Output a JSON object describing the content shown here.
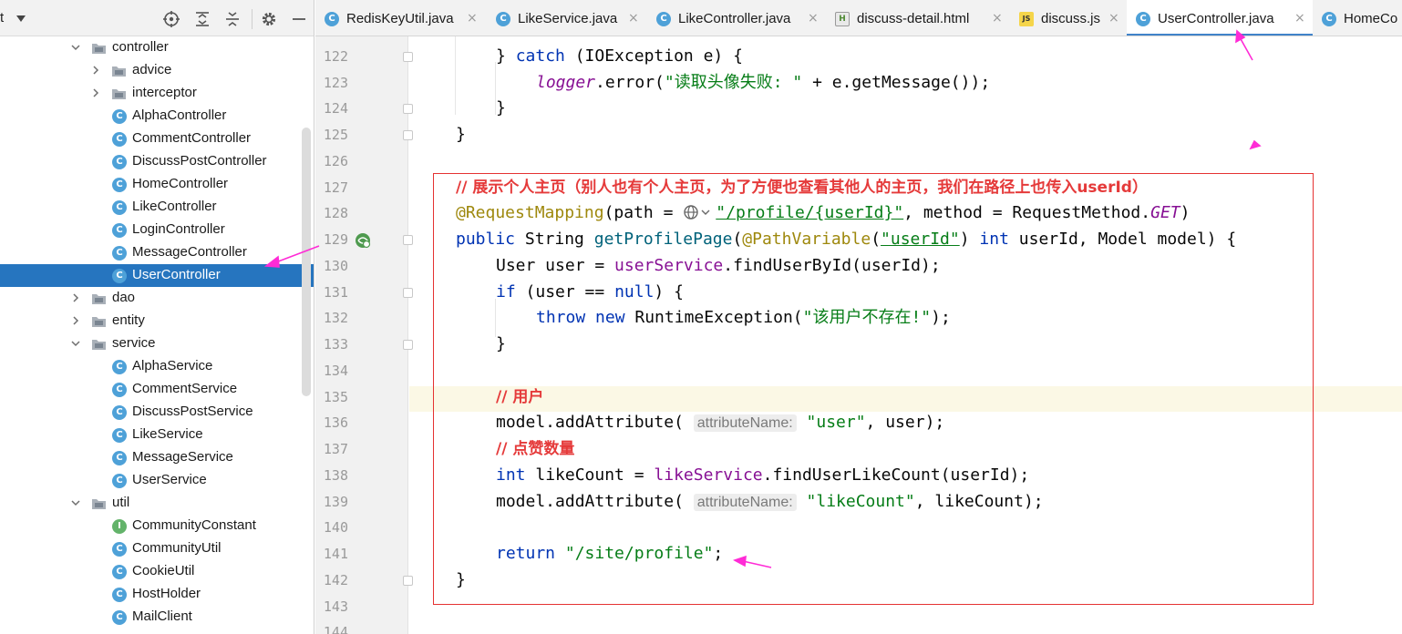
{
  "project_panel": {
    "toolbar_fragment": "t",
    "icons": [
      "target-icon",
      "expand-all-icon",
      "collapse-all-icon",
      "gear-icon",
      "minimize-icon"
    ],
    "tree": [
      {
        "label": "controller",
        "type": "folder",
        "expanded": true
      },
      {
        "label": "advice",
        "type": "folder",
        "expanded": false
      },
      {
        "label": "interceptor",
        "type": "folder",
        "expanded": false
      },
      {
        "label": "AlphaController",
        "type": "class"
      },
      {
        "label": "CommentController",
        "type": "class"
      },
      {
        "label": "DiscussPostController",
        "type": "class"
      },
      {
        "label": "HomeController",
        "type": "class"
      },
      {
        "label": "LikeController",
        "type": "class"
      },
      {
        "label": "LoginController",
        "type": "class"
      },
      {
        "label": "MessageController",
        "type": "class"
      },
      {
        "label": "UserController",
        "type": "class",
        "selected": true
      },
      {
        "label": "dao",
        "type": "folder",
        "expanded": false
      },
      {
        "label": "entity",
        "type": "folder",
        "expanded": false
      },
      {
        "label": "service",
        "type": "folder",
        "expanded": true
      },
      {
        "label": "AlphaService",
        "type": "class"
      },
      {
        "label": "CommentService",
        "type": "class"
      },
      {
        "label": "DiscussPostService",
        "type": "class"
      },
      {
        "label": "LikeService",
        "type": "class"
      },
      {
        "label": "MessageService",
        "type": "class"
      },
      {
        "label": "UserService",
        "type": "class"
      },
      {
        "label": "util",
        "type": "folder",
        "expanded": true
      },
      {
        "label": "CommunityConstant",
        "type": "interface"
      },
      {
        "label": "CommunityUtil",
        "type": "class"
      },
      {
        "label": "CookieUtil",
        "type": "class"
      },
      {
        "label": "HostHolder",
        "type": "class"
      },
      {
        "label": "MailClient",
        "type": "class"
      }
    ]
  },
  "tabs": [
    {
      "label": "RedisKeyUtil.java",
      "icon": "java-class-icon"
    },
    {
      "label": "LikeService.java",
      "icon": "java-class-icon"
    },
    {
      "label": "LikeController.java",
      "icon": "java-class-icon"
    },
    {
      "label": "discuss-detail.html",
      "icon": "html-file-icon"
    },
    {
      "label": "discuss.js",
      "icon": "js-file-icon"
    },
    {
      "label": "UserController.java",
      "icon": "java-class-icon",
      "active": true
    },
    {
      "label": "HomeCo",
      "icon": "java-class-icon"
    }
  ],
  "tab_close_glyph": "×",
  "editor": {
    "line_numbers": [
      "122",
      "123",
      "124",
      "125",
      "126",
      "127",
      "128",
      "129",
      "130",
      "131",
      "132",
      "133",
      "134",
      "135",
      "136",
      "137",
      "138",
      "139",
      "140",
      "141",
      "142",
      "143",
      "144"
    ],
    "code": {
      "l122": {
        "brace": "} ",
        "catch": "catch",
        "rest": " (IOException e) {"
      },
      "l123": {
        "logger": "logger",
        "dot": ".error(",
        "str": "\"读取头像失败: \"",
        "rest": " + e.getMessage());"
      },
      "l124": "}",
      "l125": "}",
      "l127": "// 展示个人主页（别人也有个人主页，为了方便也查看其他人的主页，我们在路径上也传入userId）",
      "l128": {
        "anno": "@RequestMapping",
        "p1": "(path = ",
        "str": "\"/profile/{userId}\"",
        "p2": ", method = RequestMethod.",
        "get": "GET",
        "p3": ")"
      },
      "l129": {
        "public": "public",
        "p1": " String ",
        "method": "getProfilePage",
        "p2": "(",
        "anno": "@PathVariable",
        "p3": "(",
        "str": "\"userId\"",
        "p4": ") ",
        "int": "int",
        "p5": " userId, Model model) {"
      },
      "l130": {
        "p1": "User user = ",
        "field": "userService",
        "p2": ".findUserById(userId);"
      },
      "l131": {
        "if": "if",
        "p1": " (user == ",
        "null": "null",
        "p2": ") {"
      },
      "l132": {
        "throw": "throw",
        "sp": " ",
        "new": "new",
        "p1": " RuntimeException(",
        "str": "\"该用户不存在!\"",
        "p2": ");"
      },
      "l133": "}",
      "l135": "// 用户",
      "l136": {
        "p1": "model.addAttribute( ",
        "hint": "attributeName:",
        "str": " \"user\"",
        "p2": ", user);"
      },
      "l137": "// 点赞数量",
      "l138": {
        "int": "int",
        "p1": " likeCount = ",
        "field": "likeService",
        "p2": ".findUserLikeCount(userId);"
      },
      "l139": {
        "p1": "model.addAttribute( ",
        "hint": "attributeName:",
        "str": " \"likeCount\"",
        "p2": ", likeCount);"
      },
      "l141": {
        "return": "return",
        "str": " \"/site/profile\"",
        "p1": ";"
      },
      "l142": "}"
    }
  },
  "colors": {
    "keyword": "#0033b3",
    "annotation": "#9e880d",
    "string": "#067d17",
    "field": "#871094",
    "annotation_red": "#e53a3a",
    "arrow_magenta": "#ff2bd6",
    "selection": "#2675bf"
  }
}
